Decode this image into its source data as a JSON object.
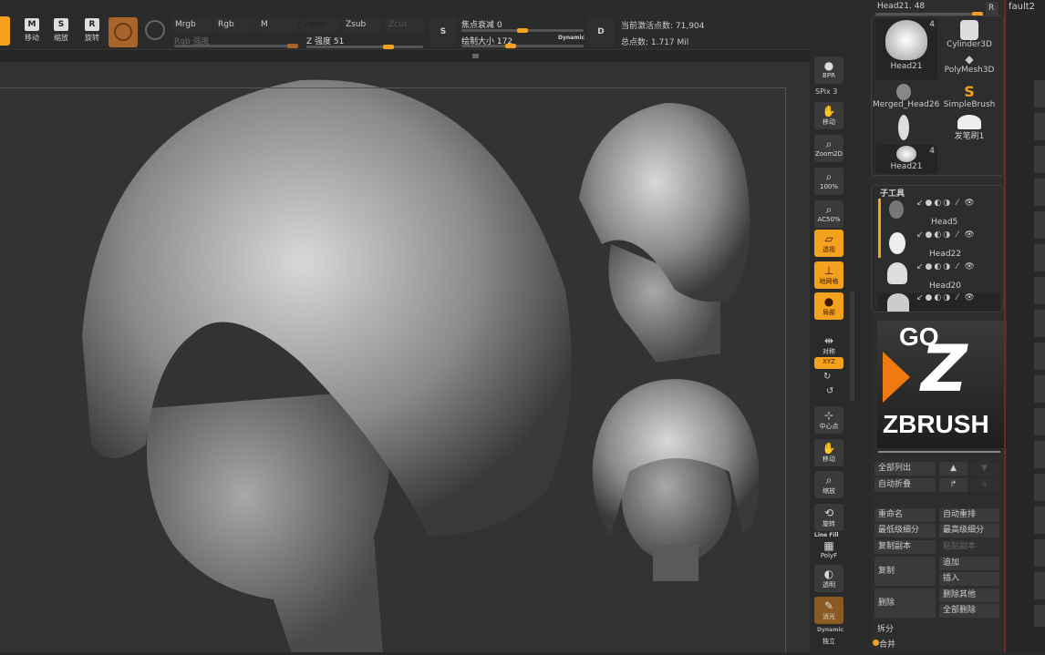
{
  "toolbar": {
    "buttons": [
      {
        "label": "移动",
        "badge": "M"
      },
      {
        "label": "缩放",
        "badge": "S"
      },
      {
        "label": "旋转",
        "badge": "R"
      }
    ],
    "modes": [
      "Mrgb",
      "Rgb",
      "M",
      "Zadd",
      "Zsub",
      "Zcut"
    ],
    "active_mode": "Zadd",
    "rgb_intensity_label": "Rgb 强度",
    "z_intensity_label": "Z 强度 51",
    "z_intensity": 51,
    "focal_shift_label": "焦点衰减 0",
    "draw_size_label": "绘制大小 172",
    "dynamic_label": "Dynamic",
    "active_points_label": "当前激活点数: 71,904",
    "total_points_label": "总点数: 1.717 Mil",
    "s_badge": "S",
    "d_badge": "D"
  },
  "shelf": {
    "items": [
      "BPR",
      "移动",
      "Zoom2D",
      "100%",
      "AC50%",
      "透视",
      "地网格",
      "局部",
      "对称",
      "XYZ",
      "中心点",
      "移动",
      "缩放",
      "旋转",
      "PolyF",
      "透明",
      "消光",
      "独立"
    ],
    "spix_label": "SPix 3",
    "dynamic_tag": "Dynamic",
    "linefill_label": "Line Fill"
  },
  "tool_panel": {
    "current_tool": "Head21. 48",
    "r_button": "R",
    "tools": [
      {
        "name": "Head21",
        "count": "4"
      },
      {
        "name": "Cylinder3D"
      },
      {
        "name": "PolyMesh3D"
      },
      {
        "name": "Merged_Head26"
      },
      {
        "name": "SimpleBrush"
      },
      {
        "name": ""
      },
      {
        "name": "发笔刷1"
      },
      {
        "name": "Head21",
        "count": "4"
      }
    ],
    "subtool_title": "子工具",
    "subtools": [
      "Head5",
      "Head22",
      "Head20",
      ""
    ],
    "logo": "GO ZBRUSH",
    "buttons": {
      "list_all": "全部列出",
      "auto_collapse": "自动折叠",
      "rename": "重命名",
      "auto_reorder": "自动重排",
      "lowest_sub": "最低级细分",
      "highest_sub": "最高级细分",
      "duplicate_copy": "复制副本",
      "paste_copy": "粘贴副本",
      "duplicate": "复制",
      "append": "追加",
      "insert": "插入",
      "delete": "删除",
      "delete_other": "删除其他",
      "delete_all": "全部删除",
      "split": "拆分",
      "merge": "合并"
    }
  },
  "panel2": {
    "title": "fault2"
  },
  "colors": {
    "accent": "#f4a21e",
    "bg": "#2b2b2b",
    "viewport": "#333333"
  }
}
